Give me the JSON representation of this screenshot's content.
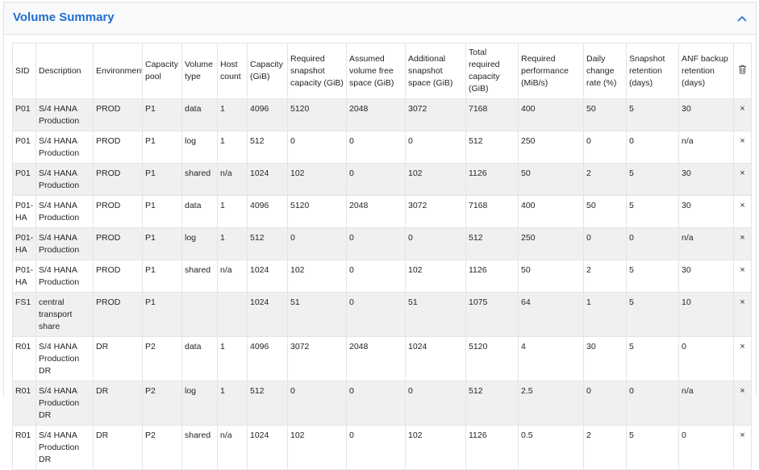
{
  "panel": {
    "title": "Volume Summary",
    "collapse_icon": "chevron-up-icon"
  },
  "table": {
    "columns": [
      "SID",
      "Description",
      "Environment",
      "Capacity pool",
      "Volume type",
      "Host count",
      "Capacity (GiB)",
      "Required snapshot capacity (GiB)",
      "Assumed volume free space (GiB)",
      "Additional snapshot space (GiB)",
      "Total required capacity (GiB)",
      "Required performance (MiB/s)",
      "Daily change rate (%)",
      "Snapshot retention (days)",
      "ANF backup retention (days)"
    ],
    "delete_header_icon": "trash-icon",
    "row_delete_symbol": "×",
    "rows": [
      [
        "P01",
        "S/4 HANA Production",
        "PROD",
        "P1",
        "data",
        "1",
        "4096",
        "5120",
        "2048",
        "3072",
        "7168",
        "400",
        "50",
        "5",
        "30"
      ],
      [
        "P01",
        "S/4 HANA Production",
        "PROD",
        "P1",
        "log",
        "1",
        "512",
        "0",
        "0",
        "0",
        "512",
        "250",
        "0",
        "0",
        "n/a"
      ],
      [
        "P01",
        "S/4 HANA Production",
        "PROD",
        "P1",
        "shared",
        "n/a",
        "1024",
        "102",
        "0",
        "102",
        "1126",
        "50",
        "2",
        "5",
        "30"
      ],
      [
        "P01-HA",
        "S/4 HANA Production",
        "PROD",
        "P1",
        "data",
        "1",
        "4096",
        "5120",
        "2048",
        "3072",
        "7168",
        "400",
        "50",
        "5",
        "30"
      ],
      [
        "P01-HA",
        "S/4 HANA Production",
        "PROD",
        "P1",
        "log",
        "1",
        "512",
        "0",
        "0",
        "0",
        "512",
        "250",
        "0",
        "0",
        "n/a"
      ],
      [
        "P01-HA",
        "S/4 HANA Production",
        "PROD",
        "P1",
        "shared",
        "n/a",
        "1024",
        "102",
        "0",
        "102",
        "1126",
        "50",
        "2",
        "5",
        "30"
      ],
      [
        "FS1",
        "central transport share",
        "PROD",
        "P1",
        "",
        "",
        "1024",
        "51",
        "0",
        "51",
        "1075",
        "64",
        "1",
        "5",
        "10"
      ],
      [
        "R01",
        "S/4 HANA Production DR",
        "DR",
        "P2",
        "data",
        "1",
        "4096",
        "3072",
        "2048",
        "1024",
        "5120",
        "4",
        "30",
        "5",
        "0"
      ],
      [
        "R01",
        "S/4 HANA Production DR",
        "DR",
        "P2",
        "log",
        "1",
        "512",
        "0",
        "0",
        "0",
        "512",
        "2.5",
        "0",
        "0",
        "n/a"
      ],
      [
        "R01",
        "S/4 HANA Production DR",
        "DR",
        "P2",
        "shared",
        "n/a",
        "1024",
        "102",
        "0",
        "102",
        "1126",
        "0.5",
        "2",
        "5",
        "0"
      ]
    ]
  }
}
